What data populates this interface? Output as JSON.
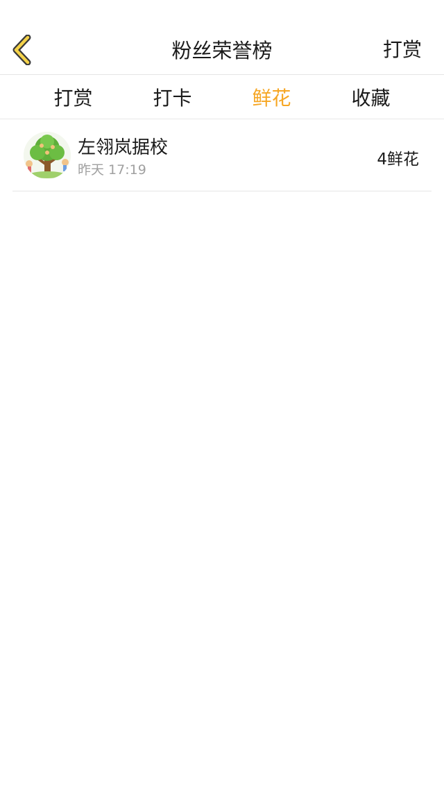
{
  "header": {
    "title": "粉丝荣誉榜",
    "right_action": "打赏"
  },
  "tabs": [
    {
      "label": "打赏"
    },
    {
      "label": "打卡"
    },
    {
      "label": "鲜花"
    },
    {
      "label": "收藏"
    }
  ],
  "active_tab": "鲜花",
  "colors": {
    "accent": "#f6a623",
    "back_icon_fill": "#f5d34a",
    "divider": "#e5e5e5"
  },
  "icons": {
    "back": "chevron-left-icon",
    "avatar": "tree-avatar-image"
  },
  "list": [
    {
      "name": "左翎岚据校",
      "time": "昨天 17:19",
      "count": "4鲜花"
    }
  ]
}
